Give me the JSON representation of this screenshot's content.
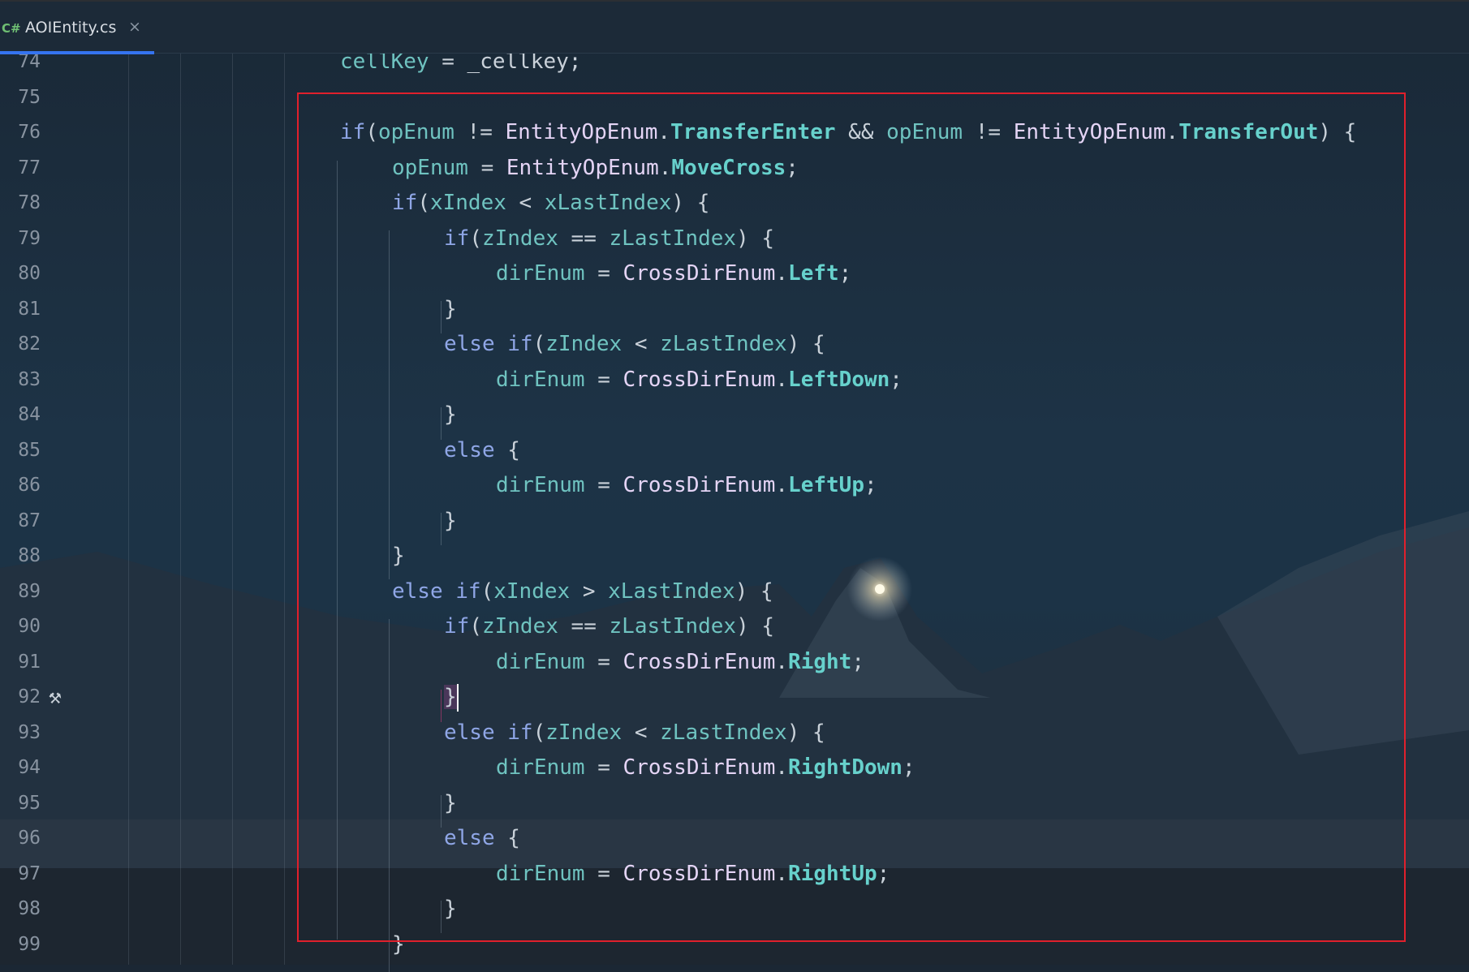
{
  "tab": {
    "lang": "C#",
    "filename": "AOIEntity.cs",
    "close": "×"
  },
  "editor": {
    "lines": [
      {
        "n": "74"
      },
      {
        "n": "75"
      },
      {
        "n": "76"
      },
      {
        "n": "77"
      },
      {
        "n": "78"
      },
      {
        "n": "79"
      },
      {
        "n": "80"
      },
      {
        "n": "81"
      },
      {
        "n": "82"
      },
      {
        "n": "83"
      },
      {
        "n": "84"
      },
      {
        "n": "85"
      },
      {
        "n": "86"
      },
      {
        "n": "87"
      },
      {
        "n": "88"
      },
      {
        "n": "89"
      },
      {
        "n": "90"
      },
      {
        "n": "91"
      },
      {
        "n": "92"
      },
      {
        "n": "93"
      },
      {
        "n": "94"
      },
      {
        "n": "95"
      },
      {
        "n": "96"
      },
      {
        "n": "97"
      },
      {
        "n": "98"
      },
      {
        "n": "99"
      }
    ],
    "gutter_icon": "hammer-icon",
    "colors": {
      "highlight_box": "#e0202c",
      "accent": "#3574f0"
    }
  },
  "tokens": {
    "kw_if": "if",
    "kw_else": "else",
    "cellKey": "cellKey",
    "_cellkey": "_cellkey",
    "opEnum": "opEnum",
    "EntityOpEnum": "EntityOpEnum",
    "TransferEnter": "TransferEnter",
    "TransferOut": "TransferOut",
    "MoveCross": "MoveCross",
    "xIndex": "xIndex",
    "xLastIndex": "xLastIndex",
    "zIndex": "zIndex",
    "zLastIndex": "zLastIndex",
    "dirEnum": "dirEnum",
    "CrossDirEnum": "CrossDirEnum",
    "Left": "Left",
    "LeftDown": "LeftDown",
    "LeftUp": "LeftUp",
    "Right": "Right",
    "RightDown": "RightDown",
    "RightUp": "RightUp",
    "eq": " = ",
    "neq": " != ",
    "eqeq": " == ",
    "lt": " < ",
    "gt": " > ",
    "and": " && ",
    "dot": ".",
    "semi": ";",
    "lp": "(",
    "rp_brace": ") {",
    "open_brace": " {",
    "close_brace": "}",
    "space": " "
  }
}
